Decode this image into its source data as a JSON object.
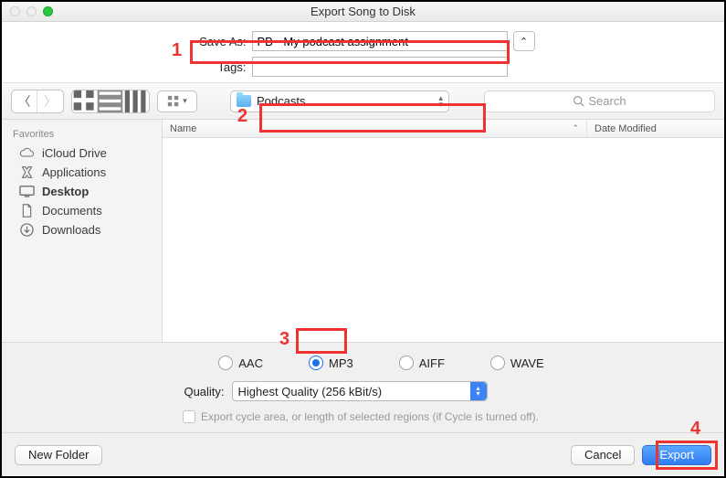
{
  "window": {
    "title": "Export Song to Disk"
  },
  "form": {
    "save_as_label": "Save As:",
    "save_as_value": "PB - My podcast assignment",
    "tags_label": "Tags:",
    "tags_value": ""
  },
  "toolbar": {
    "path_label": "Podcasts",
    "search_placeholder": "Search"
  },
  "sidebar": {
    "header": "Favorites",
    "items": [
      {
        "label": "iCloud Drive"
      },
      {
        "label": "Applications"
      },
      {
        "label": "Desktop"
      },
      {
        "label": "Documents"
      },
      {
        "label": "Downloads"
      }
    ]
  },
  "columns": {
    "name": "Name",
    "date": "Date Modified"
  },
  "formats": {
    "aac": "AAC",
    "mp3": "MP3",
    "aiff": "AIFF",
    "wave": "WAVE"
  },
  "quality": {
    "label": "Quality:",
    "value": "Highest Quality (256 kBit/s)"
  },
  "cycle_option": "Export cycle area, or length of selected regions (if Cycle is turned off).",
  "footer": {
    "new_folder": "New Folder",
    "cancel": "Cancel",
    "export": "Export"
  },
  "annotations": {
    "a1": "1",
    "a2": "2",
    "a3": "3",
    "a4": "4"
  }
}
